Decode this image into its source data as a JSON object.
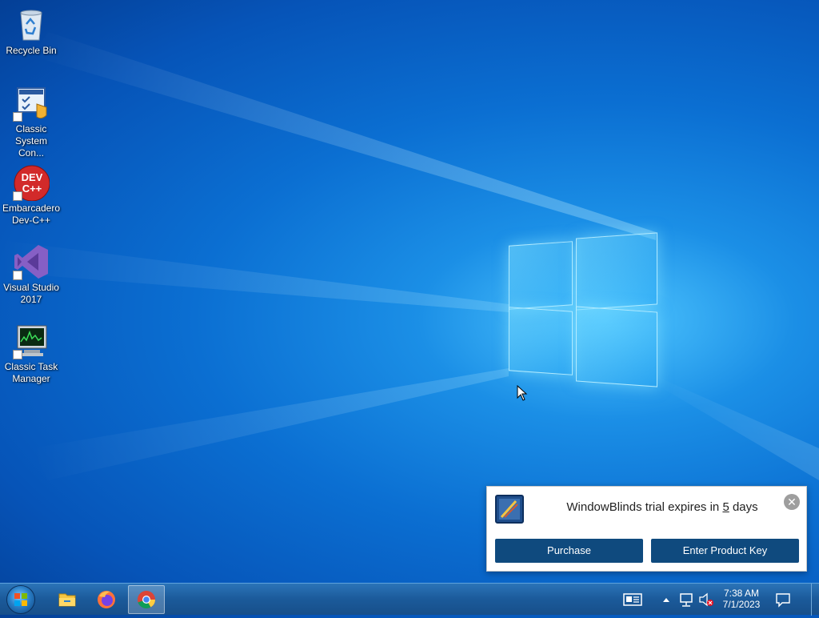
{
  "desktop": {
    "icons": [
      {
        "label": "Recycle Bin",
        "icon": "recycle-bin-icon"
      },
      {
        "label": "Classic System Con...",
        "icon": "control-panel-icon"
      },
      {
        "label": "Embarcadero Dev-C++",
        "icon": "dev-cpp-icon",
        "badge": "DEV C++"
      },
      {
        "label": "Visual Studio 2017",
        "icon": "visual-studio-icon"
      },
      {
        "label": "Classic Task Manager",
        "icon": "task-manager-icon"
      }
    ]
  },
  "notification": {
    "message_prefix": "WindowBlinds trial expires in ",
    "days": "5",
    "message_suffix": " days",
    "purchase_label": "Purchase",
    "product_key_label": "Enter Product Key",
    "close_glyph": "✕"
  },
  "taskbar": {
    "pinned": [
      "file-explorer-icon",
      "firefox-icon",
      "chrome-icon"
    ],
    "clock_time": "7:38 AM",
    "clock_date": "7/1/2023",
    "tray": [
      "news-icon",
      "show-hidden-icon",
      "network-icon",
      "volume-muted-icon",
      "action-center-icon"
    ]
  },
  "colors": {
    "wallpaper": "#0b6fd2",
    "taskbar": "#1b5a9a",
    "button": "#0f4a7e"
  }
}
